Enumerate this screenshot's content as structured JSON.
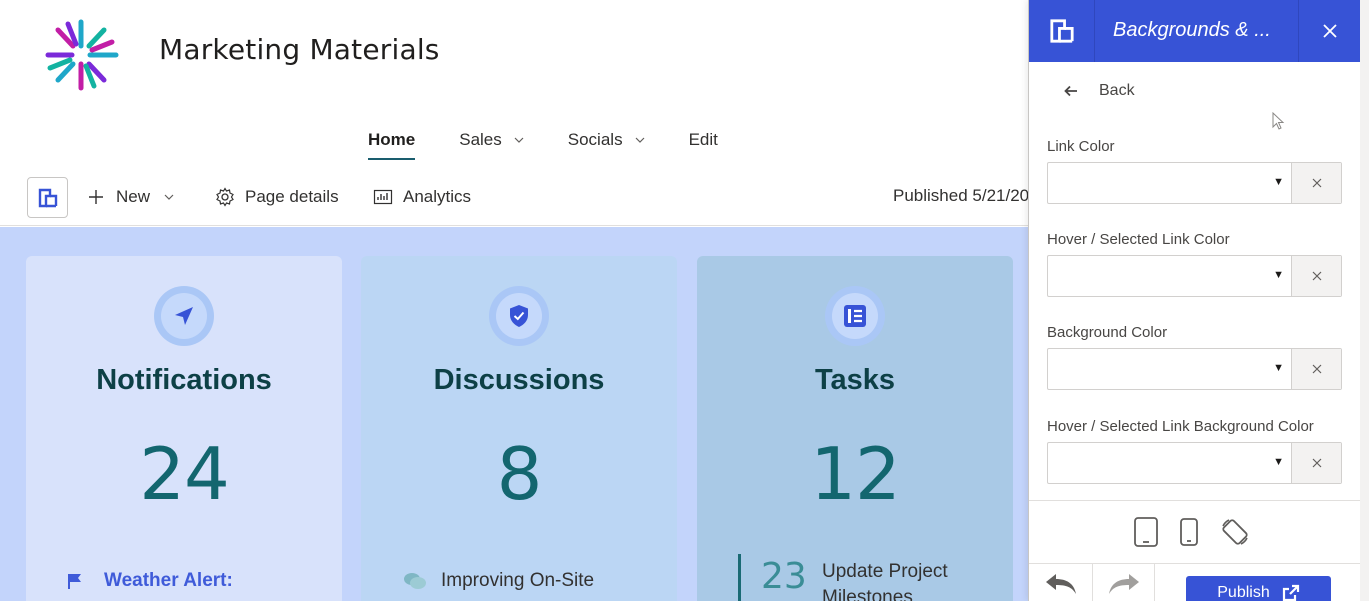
{
  "site": {
    "title": "Marketing Materials",
    "logo_icon": "starburst-logo"
  },
  "nav": {
    "items": [
      {
        "label": "Home",
        "active": true,
        "dropdown": false
      },
      {
        "label": "Sales",
        "active": false,
        "dropdown": true
      },
      {
        "label": "Socials",
        "active": false,
        "dropdown": true
      },
      {
        "label": "Edit",
        "active": false,
        "dropdown": false
      }
    ]
  },
  "command_bar": {
    "new_label": "New",
    "page_details_label": "Page details",
    "analytics_label": "Analytics",
    "published_text": "Published 5/21/20"
  },
  "cards": [
    {
      "title": "Notifications",
      "count": "24",
      "icon": "send-icon",
      "footer": "Weather Alert:",
      "footer_icon": "flag-icon"
    },
    {
      "title": "Discussions",
      "count": "8",
      "icon": "shield-check-icon",
      "footer": "Improving On-Site",
      "footer_icon": "chat-icon"
    },
    {
      "title": "Tasks",
      "count": "12",
      "icon": "list-icon",
      "task_num": "23",
      "task_line1": "Update Project",
      "task_line2": "Milestones"
    }
  ],
  "panel": {
    "title": "Backgrounds & ...",
    "back_label": "Back",
    "fields": [
      {
        "label": "Link Color"
      },
      {
        "label": "Hover / Selected Link Color"
      },
      {
        "label": "Background Color"
      },
      {
        "label": "Hover / Selected Link Background Color"
      }
    ],
    "publish_label": "Publish"
  },
  "colors": {
    "accent": "#3753d6",
    "canvas_bg": "#c3d4fb",
    "heading_teal": "#0d4046",
    "count_teal": "#13666f",
    "alert_blue": "#3f5bd9"
  }
}
